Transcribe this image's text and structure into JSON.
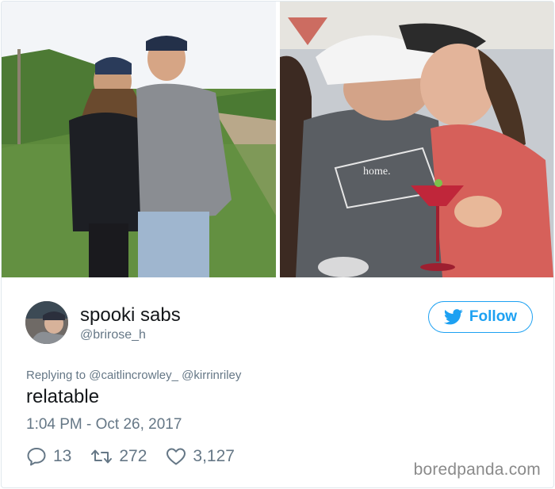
{
  "tweet": {
    "user": {
      "display_name": "spooki sabs",
      "handle": "@brirose_h"
    },
    "follow_label": "Follow",
    "replying_prefix": "Replying to",
    "reply_mentions": [
      "@caitlincrowley_",
      "@kirrinriley"
    ],
    "text": "relatable",
    "timestamp": "1:04 PM - Oct 26, 2017",
    "stats": {
      "replies": "13",
      "retweets": "272",
      "likes": "3,127"
    },
    "photos": [
      {
        "icon": "photo-orchard-couple"
      },
      {
        "icon": "photo-kissing-couple",
        "shirt_text": "home."
      }
    ]
  },
  "watermark": "boredpanda.com",
  "colors": {
    "twitter_blue": "#1da1f2",
    "muted_text": "#657786",
    "main_text": "#14171a"
  }
}
